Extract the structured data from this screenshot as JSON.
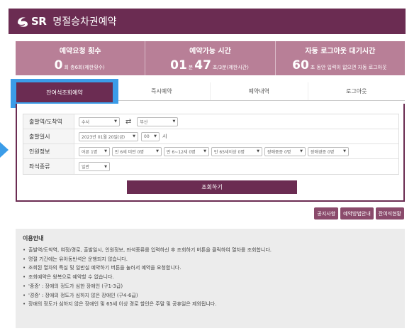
{
  "header": {
    "logo_text": "SR",
    "title": "명절승차권예약"
  },
  "stats": {
    "request_count": {
      "label": "예약요청 횟수",
      "value": "0",
      "suffix": "회 총6회(제한횟수)"
    },
    "available_time": {
      "label": "예약가능 시간",
      "minutes": "01",
      "minutes_unit": "분",
      "seconds": "47",
      "seconds_suffix": "초/3분(제한시간)"
    },
    "auto_logout": {
      "label": "자동 로그아웃 대기시간",
      "value": "60",
      "suffix": "초 동안 입력이 없으면 자동 로그아웃"
    }
  },
  "tabs": [
    {
      "label": "잔여석조회예약",
      "active": true
    },
    {
      "label": "즉시예약",
      "active": false
    },
    {
      "label": "예약내역",
      "active": false
    },
    {
      "label": "로그아웃",
      "active": false
    }
  ],
  "form": {
    "route": {
      "label": "출발역/도착역",
      "departure": "수서",
      "arrival": "부산",
      "swap_symbol": "⇄"
    },
    "date": {
      "label": "출발일시",
      "date_value": "2023년 01월 20일(금)",
      "hour_value": "00",
      "hour_unit": "시"
    },
    "passengers": {
      "label": "인원정보",
      "options": [
        "어른 1명",
        "만 6세 미만 0명",
        "만 6~12세 0명",
        "만 65세이상 0명",
        "장애중증 0명",
        "장애경증 0명"
      ]
    },
    "seat": {
      "label": "좌석종류",
      "value": "일반"
    },
    "search_button": "조회하기"
  },
  "aux_buttons": [
    "공지사항",
    "예약방법안내",
    "잔여석현황"
  ],
  "notice": {
    "title": "이용안내",
    "items": [
      "출발역/도착역, 여정/경로, 출발일시, 인원정보, 좌석종류를 입력하신 후 조회하기 버튼을 클릭하여 열차를 조회합니다.",
      "명절 기간에는 유아동반석은 운행되지 않습니다.",
      "조회된 열차의 특실 및 일반실 예약하기 버튼을 눌러서 예약을 요청합니다.",
      "조회예약은 왕복으로 예약할 수 없습니다.",
      "'중증' : 장애의 정도가 심한 장애인 (구1-3급)",
      "'경증' : 장애의 정도가 심하지 않은 장애인 (구4-6급)",
      "장애의 정도가 심하지 않은 장애인 및 65세 이상 경로 할인은 주말 및 공휴일은 제외됩니다."
    ]
  },
  "colors": {
    "brand": "#6b2c52",
    "stats_bg": "#b87f97",
    "highlight": "#3b9ce8"
  }
}
